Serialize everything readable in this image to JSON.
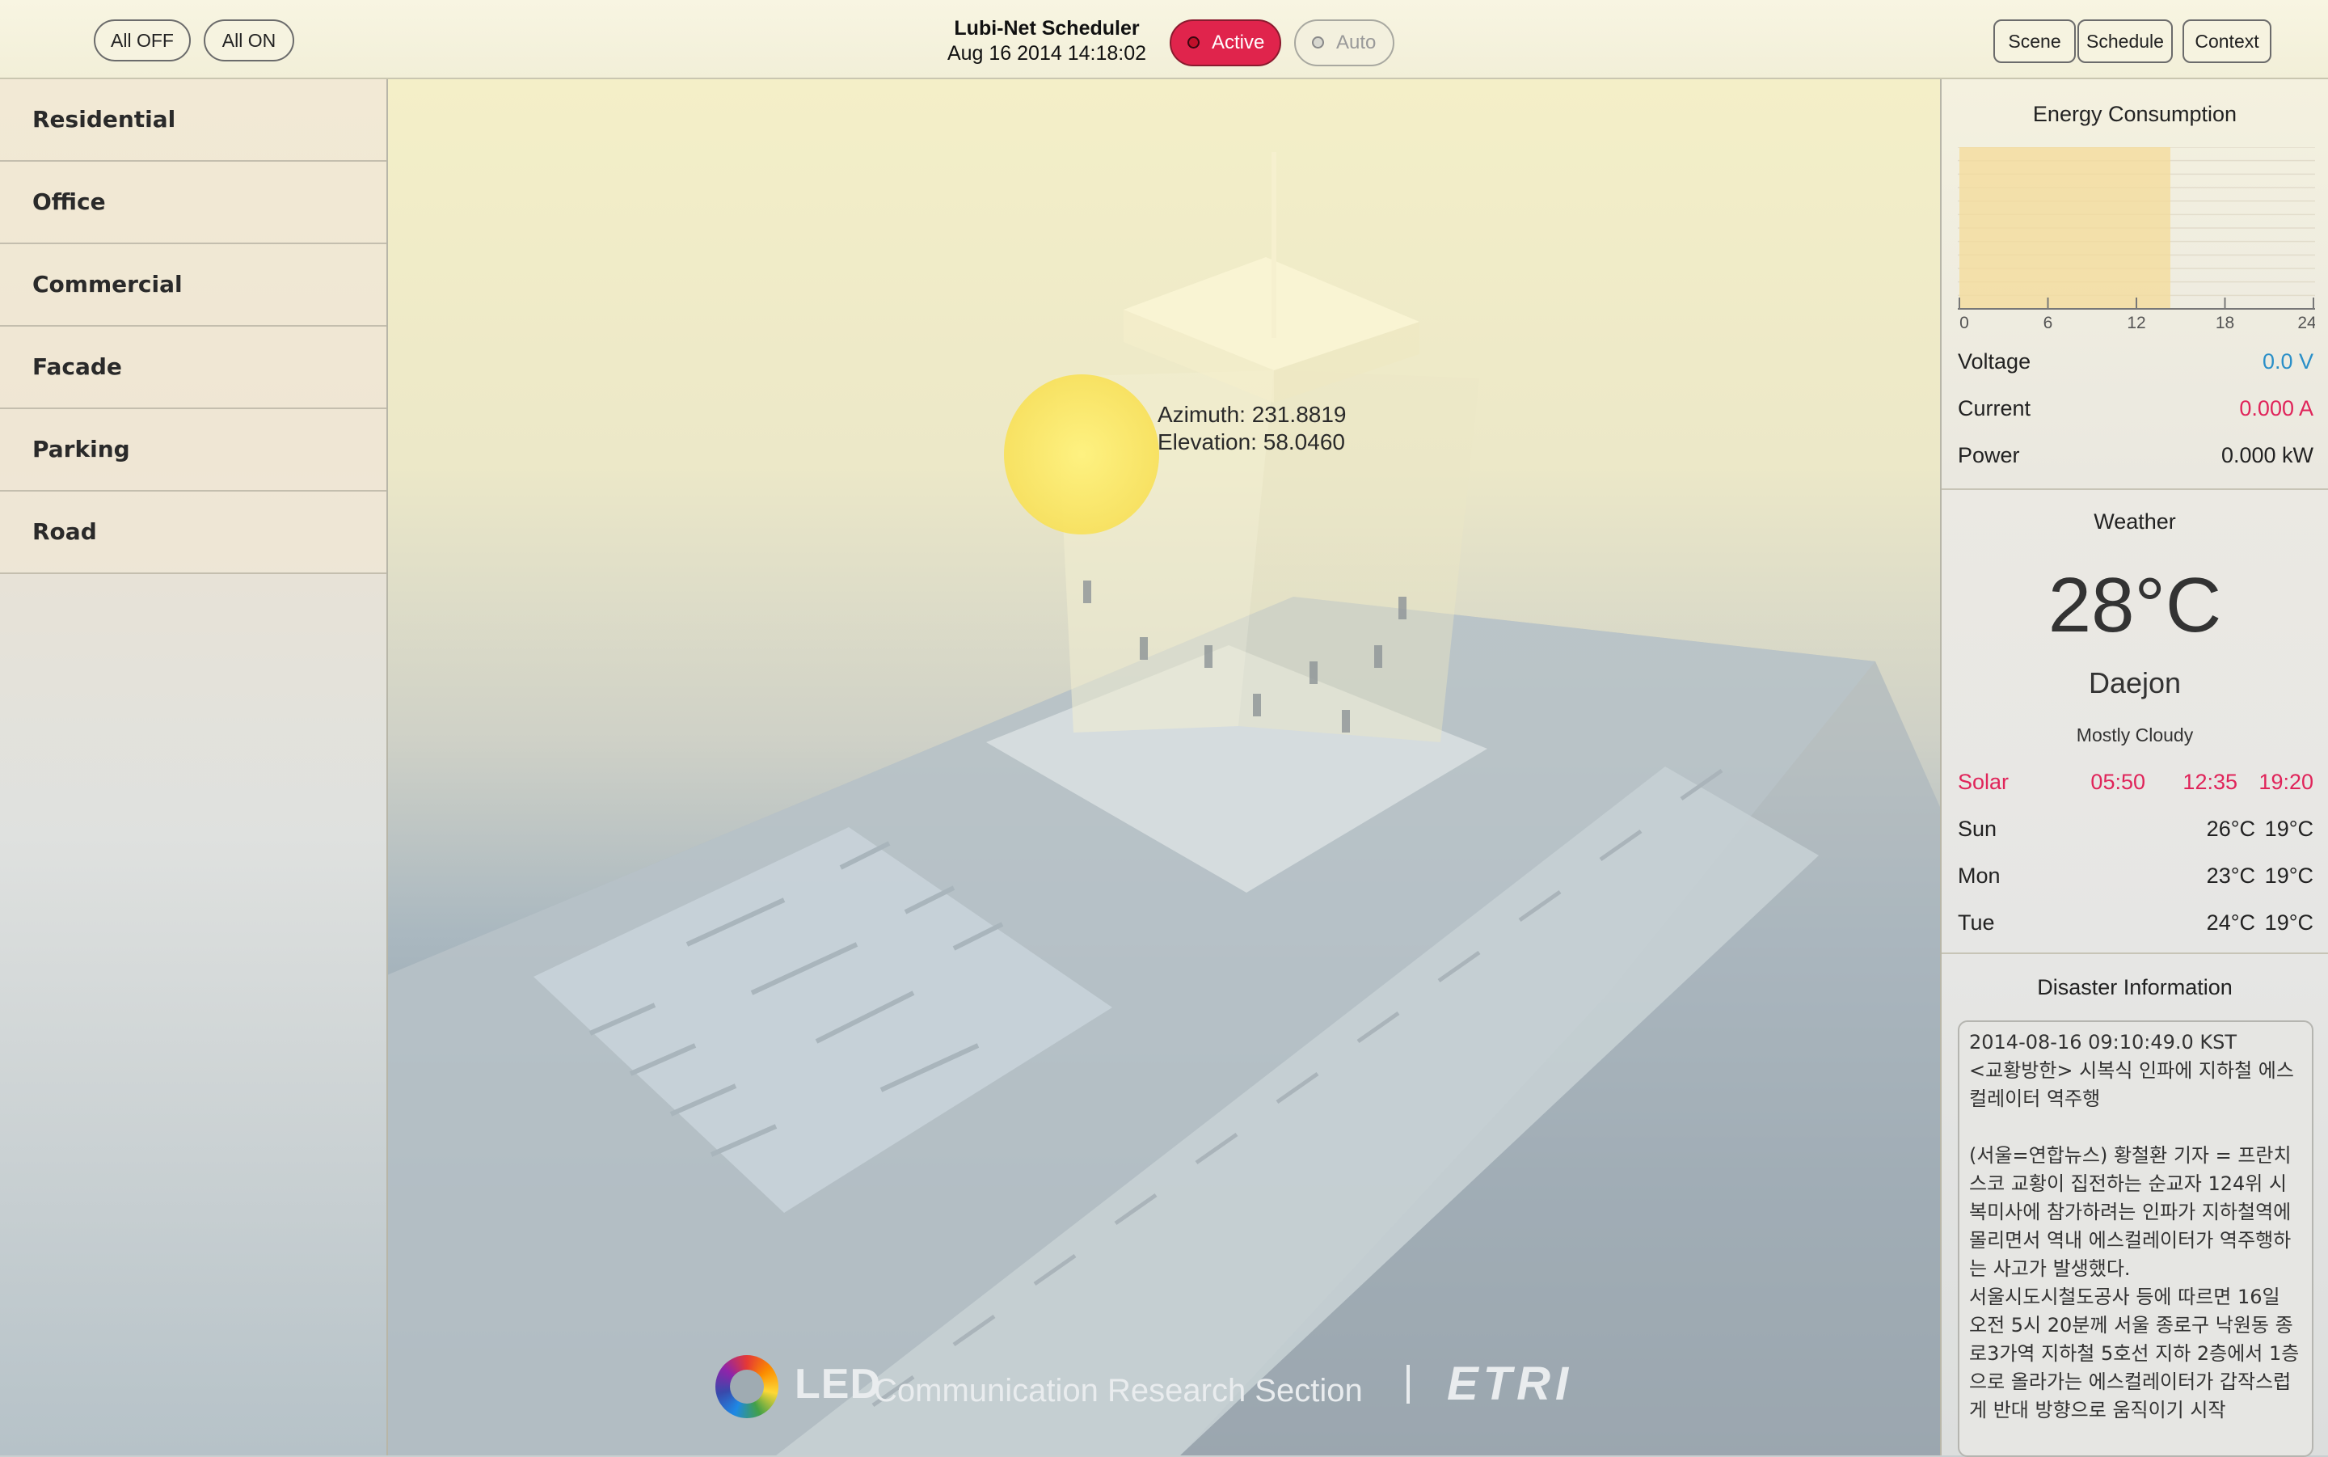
{
  "header": {
    "all_off": "All OFF",
    "all_on": "All ON",
    "title": "Lubi-Net Scheduler",
    "datetime": "Aug 16 2014 14:18:02",
    "active_label": "Active",
    "auto_label": "Auto",
    "scene_label": "Scene",
    "schedule_label": "Schedule",
    "context_label": "Context"
  },
  "sidebar": {
    "items": [
      {
        "label": "Residential"
      },
      {
        "label": "Office"
      },
      {
        "label": "Commercial"
      },
      {
        "label": "Facade"
      },
      {
        "label": "Parking"
      },
      {
        "label": "Road"
      }
    ]
  },
  "scene": {
    "azimuth": "Azimuth: 231.8819",
    "elevation": "Elevation: 58.0460",
    "logo_led": "LED",
    "logo_section": "Communication Research Section",
    "logo_org": "ETRI"
  },
  "energy": {
    "title": "Energy Consumption",
    "chart_data": {
      "type": "area",
      "x_ticks": [
        "0",
        "6",
        "12",
        "18",
        "24"
      ],
      "xlim": [
        0,
        24
      ],
      "elapsed_hours": 14.3
    },
    "voltage_label": "Voltage",
    "voltage_value": "0.0 V",
    "current_label": "Current",
    "current_value": "0.000 A",
    "power_label": "Power",
    "power_value": "0.000 kW",
    "colors": {
      "voltage": "#2a8fc8",
      "current": "#e0245a"
    }
  },
  "weather": {
    "title": "Weather",
    "temperature": "28°C",
    "city": "Daejon",
    "condition": "Mostly Cloudy",
    "solar": {
      "label": "Solar",
      "t1": "05:50",
      "t2": "12:35",
      "t3": "19:20"
    },
    "forecast": [
      {
        "day": "Sun",
        "high": "26°C",
        "low": "19°C"
      },
      {
        "day": "Mon",
        "high": "23°C",
        "low": "19°C"
      },
      {
        "day": "Tue",
        "high": "24°C",
        "low": "19°C"
      }
    ]
  },
  "disaster": {
    "title": "Disaster Information",
    "text": "2014-08-16 09:10:49.0 KST\n<교황방한> 시복식 인파에 지하철 에스컬레이터 역주행\n\n(서울=연합뉴스) 황철환 기자 = 프란치스코 교황이 집전하는 순교자 124위 시복미사에 참가하려는 인파가 지하철역에 몰리면서 역내 에스컬레이터가 역주행하는 사고가 발생했다.\n서울시도시철도공사 등에 따르면 16일 오전 5시 20분께 서울 종로구 낙원동 종로3가역 지하철 5호선 지하 2층에서 1층으로 올라가는 에스컬레이터가 갑작스럽게 반대 방향으로 움직이기 시작"
  }
}
